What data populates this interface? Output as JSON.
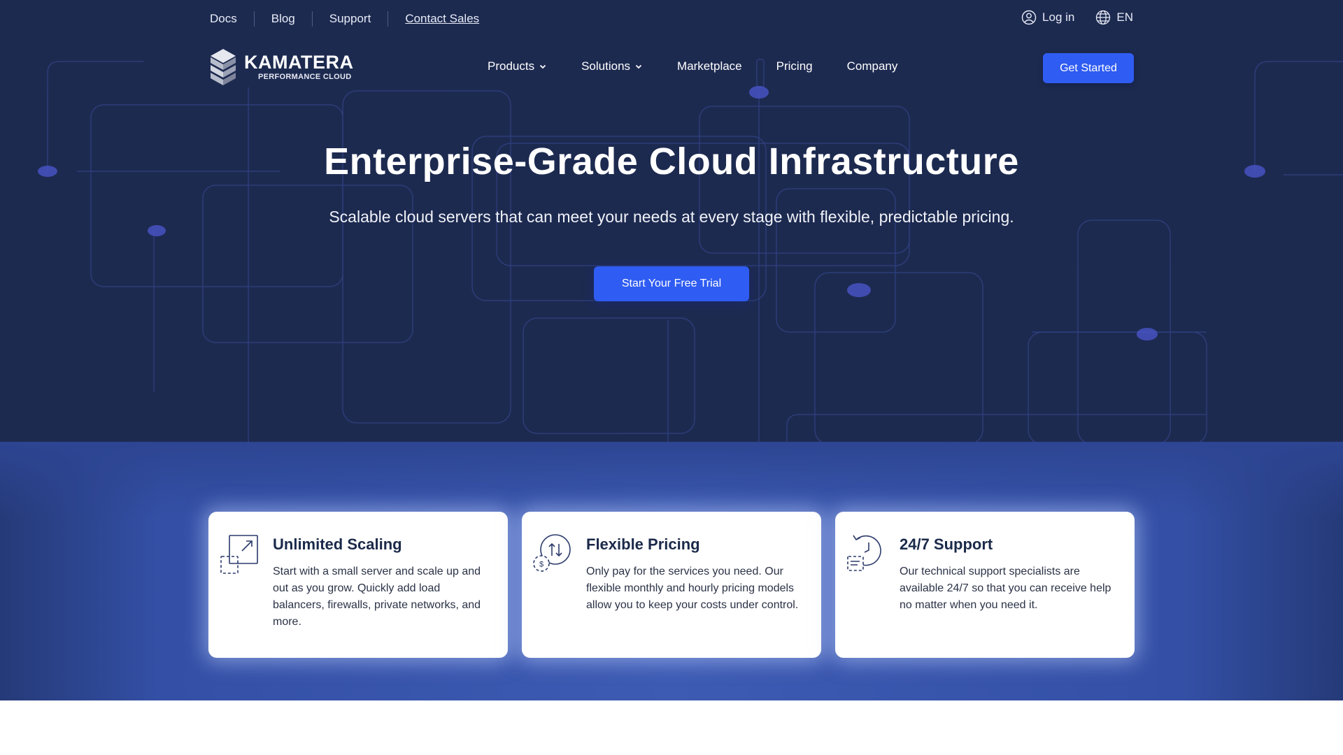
{
  "topbar": {
    "links": [
      "Docs",
      "Blog",
      "Support",
      "Contact Sales"
    ],
    "login": "Log in",
    "language": "EN"
  },
  "brand": {
    "name": "KAMATERA",
    "tagline": "PERFORMANCE CLOUD"
  },
  "nav": {
    "items": [
      {
        "label": "Products",
        "icon": "chevron-down-icon"
      },
      {
        "label": "Solutions",
        "icon": "chevron-down-icon"
      },
      {
        "label": "Marketplace"
      },
      {
        "label": "Pricing"
      },
      {
        "label": "Company"
      }
    ],
    "cta": "Get Started"
  },
  "hero": {
    "headline": "Enterprise-Grade Cloud Infrastructure",
    "subheadline": "Scalable cloud servers that can meet your needs at every stage with flexible, predictable pricing.",
    "cta": "Start Your Free Trial"
  },
  "features": [
    {
      "icon": "scale-up-icon",
      "title": "Unlimited Scaling",
      "text": "Start with a small server and scale up and out as you grow. Quickly add load balancers, firewalls, private networks, and more."
    },
    {
      "icon": "dollar-arrows-icon",
      "title": "Flexible Pricing",
      "text": "Only pay for the services you need. Our flexible monthly and hourly pricing models allow you to keep your costs under control."
    },
    {
      "icon": "clock-support-icon",
      "title": "24/7 Support",
      "text": "Our technical support specialists are available 24/7 so that you can receive help no matter when you need it."
    }
  ],
  "colors": {
    "hero_bg": "#1d2a50",
    "accent": "#2f5cf2",
    "band_bg": "#3d5bb3",
    "card_title": "#1b2a4a"
  }
}
